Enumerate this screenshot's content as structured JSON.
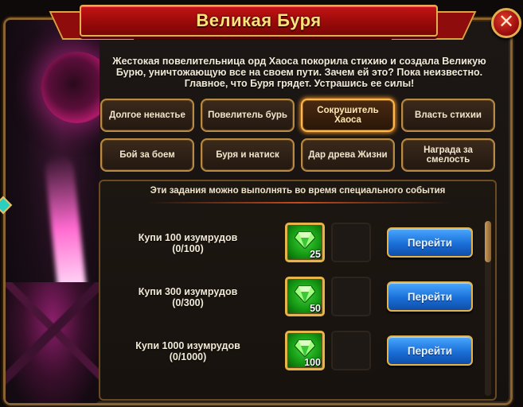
{
  "title": "Великая Буря",
  "description": "Жестокая повелительница орд Хаоса покорила стихию и создала Великую Бурю, уничтожающую все на своем пути. Зачем ей это? Пока неизвестно. Главное, что Буря грядет. Устрашись ее силы!",
  "tabs": [
    {
      "label": "Долгое ненастье",
      "active": false
    },
    {
      "label": "Повелитель бурь",
      "active": false
    },
    {
      "label": "Сокрушитель Хаоса",
      "active": true
    },
    {
      "label": "Власть стихии",
      "active": false
    },
    {
      "label": "Бой за боем",
      "active": false
    },
    {
      "label": "Буря и натиск",
      "active": false
    },
    {
      "label": "Дар древа Жизни",
      "active": false
    },
    {
      "label": "Награда за смелость",
      "active": false
    }
  ],
  "panel": {
    "header": "Эти задания можно выполнять во время специального события",
    "tasks": [
      {
        "title": "Купи 100 изумрудов",
        "progress": "(0/100)",
        "reward_count": "25",
        "button": "Перейти"
      },
      {
        "title": "Купи 300 изумрудов",
        "progress": "(0/300)",
        "reward_count": "50",
        "button": "Перейти"
      },
      {
        "title": "Купи 1000 изумрудов",
        "progress": "(0/1000)",
        "reward_count": "100",
        "button": "Перейти"
      }
    ]
  },
  "icons": {
    "close": "close-icon",
    "reward": "emerald-icon"
  },
  "colors": {
    "ribbon": "#c41414",
    "title_text": "#ffe27a",
    "button": "#1a6fd8",
    "reward_bg": "#169a14",
    "active_tab_glow": "#ff9a2a"
  }
}
